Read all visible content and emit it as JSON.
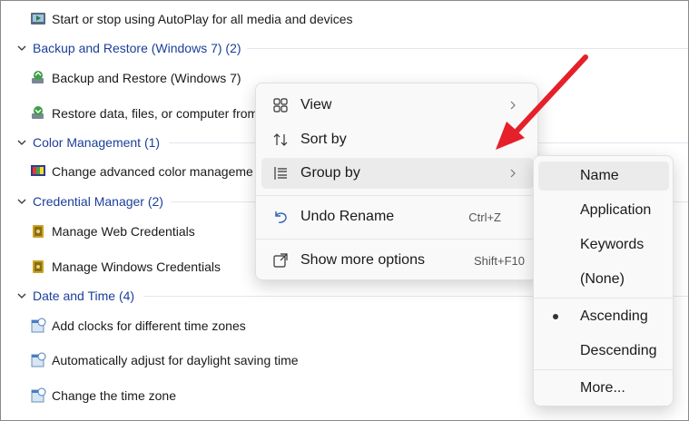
{
  "list": {
    "autoplay_task": "Start or stop using AutoPlay for all media and devices",
    "groups": [
      {
        "header": "Backup and Restore (Windows 7) (2)",
        "tasks": [
          "Backup and Restore (Windows 7)",
          "Restore data, files, or computer from"
        ]
      },
      {
        "header": "Color Management (1)",
        "tasks": [
          "Change advanced color manageme"
        ]
      },
      {
        "header": "Credential Manager (2)",
        "tasks": [
          "Manage Web Credentials",
          "Manage Windows Credentials"
        ]
      },
      {
        "header": "Date and Time (4)",
        "tasks": [
          "Add clocks for different time zones",
          "Automatically adjust for daylight saving time",
          "Change the time zone"
        ]
      }
    ]
  },
  "context_menu": {
    "items": [
      {
        "label": "View",
        "icon": "grid-icon",
        "submenu": true
      },
      {
        "label": "Sort by",
        "icon": "sort-icon",
        "submenu": true
      },
      {
        "label": "Group by",
        "icon": "group-by-icon",
        "submenu": true,
        "active": true
      },
      {
        "label": "Undo Rename",
        "icon": "undo-icon",
        "shortcut": "Ctrl+Z"
      },
      {
        "label": "Show more options",
        "icon": "show-more-icon",
        "shortcut": "Shift+F10"
      }
    ]
  },
  "group_by_submenu": {
    "items": [
      "Name",
      "Application",
      "Keywords",
      "(None)"
    ],
    "order": [
      "Ascending",
      "Descending"
    ],
    "selected_order": "Ascending",
    "more": "More..."
  },
  "colors": {
    "group_header": "#1b3f9a",
    "annotation_arrow": "#e5202a",
    "menu_bg": "#f9f9f9",
    "highlight": "#ebebeb"
  }
}
